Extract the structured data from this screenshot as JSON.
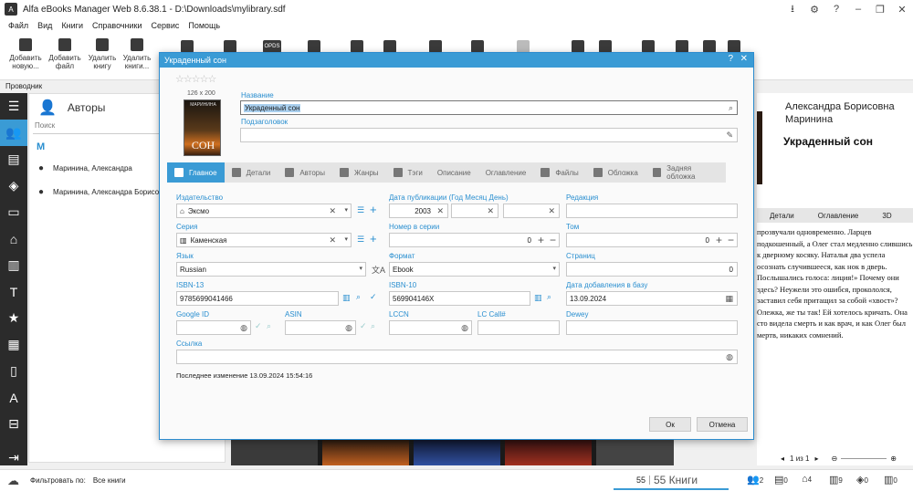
{
  "window": {
    "title": "Alfa eBooks Manager Web 8.6.38.1 - D:\\Downloads\\mylibrary.sdf"
  },
  "menu": [
    "Файл",
    "Вид",
    "Книги",
    "Справочники",
    "Сервис",
    "Помощь"
  ],
  "toolbar": {
    "add_new": "Добавить новую...",
    "add_file": "Добавить файл",
    "delete_book": "Удалить книгу",
    "delete_books": "Удалить книги...",
    "opds": "OPDS"
  },
  "explorer": {
    "title": "Проводник"
  },
  "left_panel": {
    "title": "Авторы",
    "search_placeholder": "Поиск",
    "letter": "М",
    "authors": [
      "Маринина, Александра",
      "Маринина, Александра Борисовна"
    ]
  },
  "right_panel": {
    "author": "Александра Борисовна Маринина",
    "title": "Украденный сон",
    "tabs": [
      "Детали",
      "Оглавление",
      "3D"
    ],
    "text": "прозвучали одновременно. Ларцев подкошенный, а Олег стал медленно слившись к дверному косяку. Наталья два успела осознать случившееся, как нок в дверь. Послышались голоса: лиция!» Почему они здесь? Неужели это ошибся, прокололся, заставил себя притащил за собой «хвост»? Олежка, же ты так! Ей хотелось кричать. Она сто видела смерть и как врач, и как Олег был мертв, никаких сомнений.",
    "page": "1 из 1"
  },
  "status": {
    "filter_label": "Фильтровать по:",
    "filter_value": "Все книги",
    "count": "55",
    "count_label": "55 Книги",
    "stats": [
      "2",
      "0",
      "4",
      "9",
      "0",
      "0"
    ]
  },
  "dialog": {
    "title": "Украденный сон",
    "cover_size": "126 x 200",
    "cover_author": "МАРИНИНА",
    "cover_title": "СОН",
    "name_label": "Название",
    "name_value": "Украденный сон",
    "subtitle_label": "Подзаголовок",
    "subtitle_value": "",
    "tabs": [
      "Главное",
      "Детали",
      "Авторы",
      "Жанры",
      "Тэги",
      "Описание",
      "Оглавление",
      "Файлы",
      "Обложка",
      "Задняя обложка"
    ],
    "fields": {
      "publisher_label": "Издательство",
      "publisher_value": "Эксмо",
      "pubdate_label": "Дата публикации  (Год Месяц День)",
      "pubdate_year": "2003",
      "edition_label": "Редакция",
      "edition_value": "",
      "series_label": "Серия",
      "series_value": "Каменская",
      "series_num_label": "Номер в серии",
      "series_num_value": "0",
      "volume_label": "Том",
      "volume_value": "0",
      "language_label": "Язык",
      "language_value": "Russian",
      "format_label": "Формат",
      "format_value": "Ebook",
      "pages_label": "Страниц",
      "pages_value": "0",
      "isbn13_label": "ISBN-13",
      "isbn13_value": "9785699041466",
      "isbn10_label": "ISBN-10",
      "isbn10_value": "569904146X",
      "added_label": "Дата добавления в базу",
      "added_value": "13.09.2024",
      "google_label": "Google ID",
      "asin_label": "ASIN",
      "lccn_label": "LCCN",
      "lccall_label": "LC Call#",
      "dewey_label": "Dewey",
      "link_label": "Ссылка"
    },
    "last_modified": "Последнее изменение  13.09.2024 15:54:16",
    "ok": "Ок",
    "cancel": "Отмена"
  }
}
